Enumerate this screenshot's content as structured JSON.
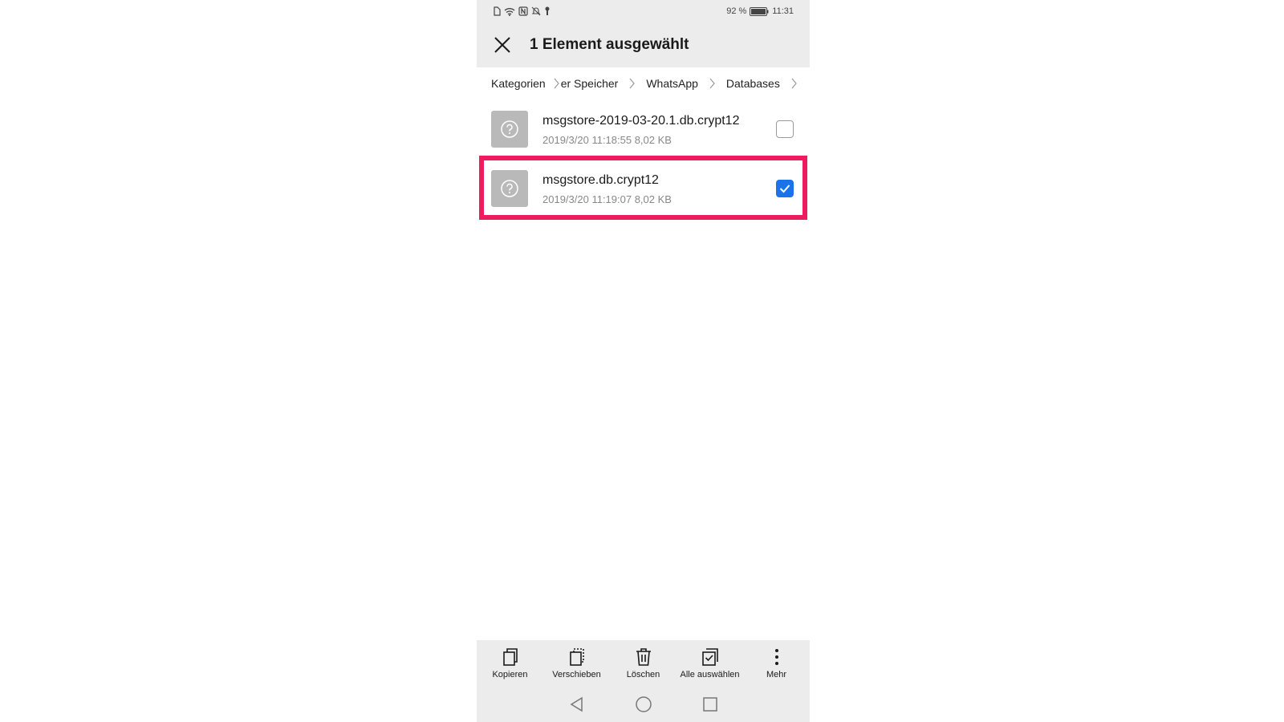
{
  "status_bar": {
    "battery_percent": "92 %",
    "time": "11:31",
    "icons": [
      "sim-icon",
      "wifi-icon",
      "nfc-icon",
      "mute-icon",
      "key-icon",
      "battery-icon"
    ]
  },
  "header": {
    "title": "1 Element ausgewählt",
    "close_icon": "close-icon"
  },
  "breadcrumb": {
    "items": [
      "Kategorien",
      "er Speicher",
      "WhatsApp",
      "Databases"
    ]
  },
  "files": [
    {
      "name": "msgstore-2019-03-20.1.db.crypt12",
      "meta": "2019/3/20 11:18:55 8,02 KB",
      "checked": false
    },
    {
      "name": "msgstore.db.crypt12",
      "meta": "2019/3/20 11:19:07 8,02 KB",
      "checked": true
    }
  ],
  "toolbar": {
    "items": [
      {
        "label": "Kopieren",
        "icon": "copy-icon"
      },
      {
        "label": "Verschieben",
        "icon": "move-icon"
      },
      {
        "label": "Löschen",
        "icon": "delete-icon"
      },
      {
        "label": "Alle auswählen",
        "icon": "select-all-icon"
      },
      {
        "label": "Mehr",
        "icon": "more-icon"
      }
    ]
  },
  "nav_bar": {
    "icons": [
      "back-icon",
      "home-icon",
      "recents-icon"
    ]
  },
  "colors": {
    "accent": "#1a73e8",
    "highlight": "#ee1c5f",
    "bar_background": "#ececec"
  }
}
